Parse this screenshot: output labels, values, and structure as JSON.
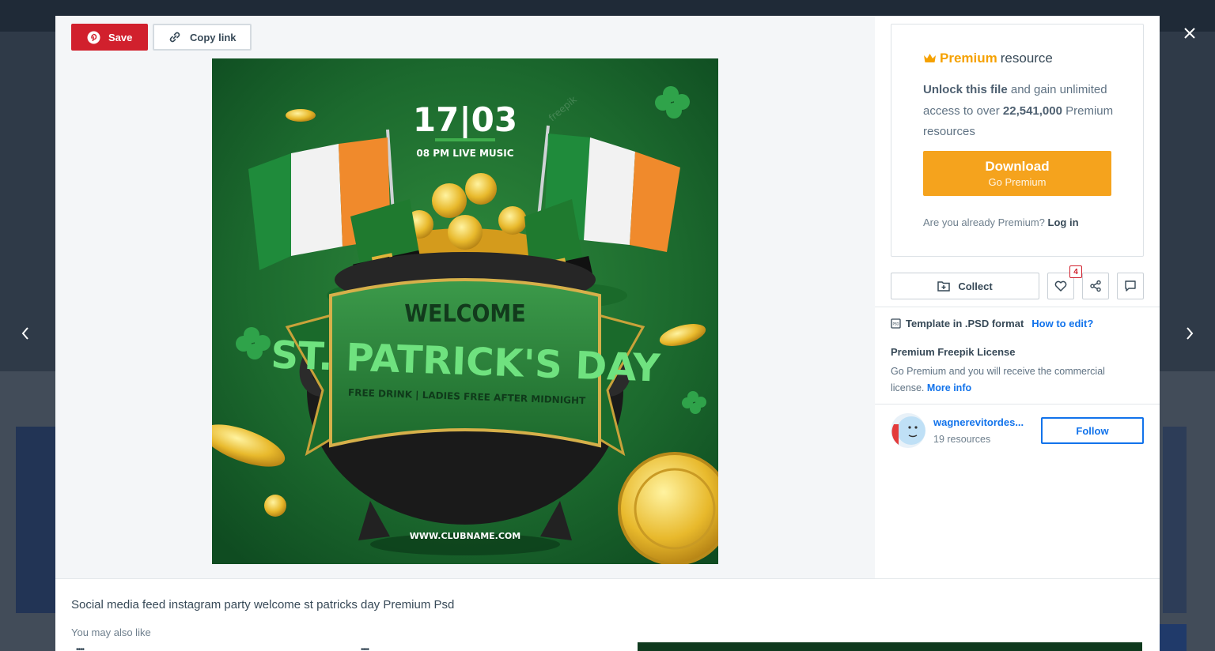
{
  "toolbar": {
    "save_label": "Save",
    "copy_link_label": "Copy link"
  },
  "preview": {
    "date": "17|03",
    "subtitle": "08 PM LIVE MUSIC",
    "welcome": "WELCOME",
    "headline": "ST. PATRICK'S DAY",
    "tagline": "FREE DRINK | LADIES FREE AFTER MIDNIGHT",
    "website": "WWW.CLUBNAME.COM",
    "watermark": "freepik"
  },
  "premium": {
    "title_highlight": "Premium",
    "title_rest": "resource",
    "unlock_bold": "Unlock this file",
    "unlock_text": "and gain unlimited access to over",
    "count_bold": "22,541,000",
    "count_text": "Premium resources",
    "download_label": "Download",
    "download_sub": "Go Premium",
    "already_text": "Are you already Premium?",
    "login_label": "Log in"
  },
  "actions": {
    "collect_label": "Collect",
    "like_count": "4"
  },
  "format": {
    "label": "Template in .PSD format",
    "how_label": "How to edit?"
  },
  "license": {
    "title": "Premium Freepik License",
    "text": "Go Premium and you will receive the commercial license.",
    "more_label": "More info"
  },
  "author": {
    "name": "wagnerevitordes...",
    "resources": "19 resources",
    "follow_label": "Follow"
  },
  "resource": {
    "title": "Social media feed instagram party welcome st patricks day Premium Psd",
    "you_may_also_like": "You may also like",
    "related_dots": "••••"
  },
  "colors": {
    "save_red": "#d1202d",
    "premium_orange": "#f5a100",
    "download_orange": "#f5a31d",
    "link_blue": "#1273eb",
    "flyer_green": "#1f6b32"
  }
}
